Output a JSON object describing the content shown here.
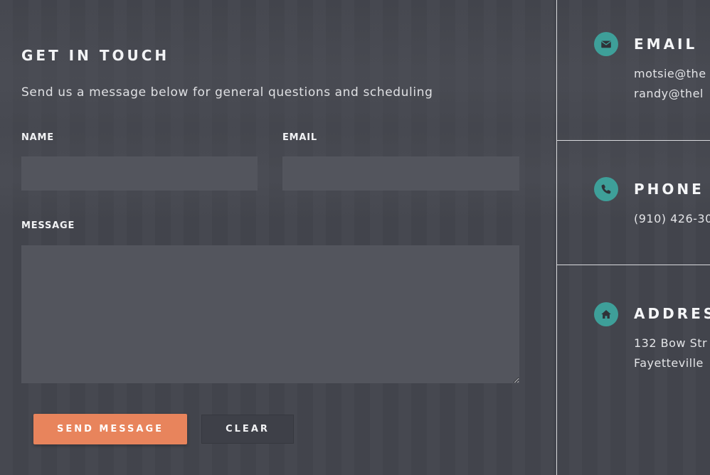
{
  "form": {
    "title": "GET IN TOUCH",
    "subtitle": "Send us a message below for general questions and scheduling",
    "name_label": "NAME",
    "name_value": "",
    "email_label": "EMAIL",
    "email_value": "",
    "message_label": "MESSAGE",
    "message_value": "",
    "send_label": "SEND MESSAGE",
    "clear_label": "CLEAR"
  },
  "contact": {
    "email": {
      "title": "EMAIL",
      "icon": "envelope-icon",
      "lines": [
        "motsie@the",
        "randy@thel"
      ]
    },
    "phone": {
      "title": "PHONE",
      "icon": "phone-icon",
      "lines": [
        "(910) 426-30"
      ]
    },
    "address": {
      "title": "ADDRES",
      "icon": "home-icon",
      "lines": [
        "132 Bow Str",
        "Fayetteville"
      ]
    }
  },
  "colors": {
    "background": "#43454d",
    "field": "#53555d",
    "accent_button": "#e8845c",
    "icon_circle": "#3e9f99",
    "divider": "#d9dadd"
  }
}
